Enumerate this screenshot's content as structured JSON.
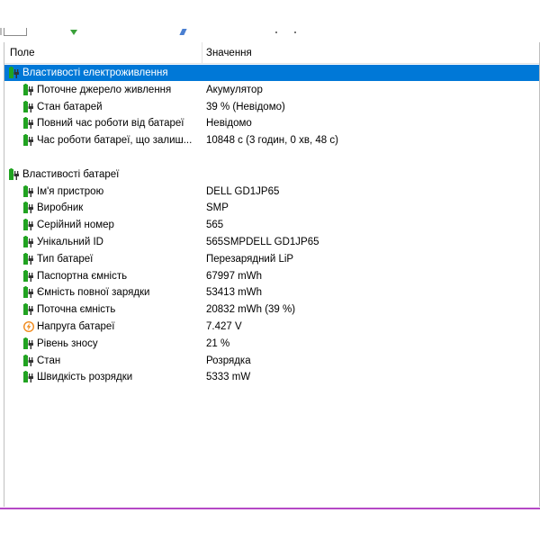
{
  "columns": {
    "field": "Поле",
    "value": "Значення"
  },
  "groups": [
    {
      "label": "Властивості електроживлення",
      "selected": true,
      "items": [
        {
          "name": "Поточне джерело живлення",
          "value": "Акумулятор",
          "icon": "battery-plug-icon"
        },
        {
          "name": "Стан батарей",
          "value": "39 % (Невідомо)",
          "icon": "battery-plug-icon"
        },
        {
          "name": "Повний час роботи від батареї",
          "value": "Невідомо",
          "icon": "battery-plug-icon"
        },
        {
          "name": "Час роботи батареї, що залиш...",
          "value": "10848 с (3 годин, 0 хв, 48 с)",
          "icon": "battery-plug-icon"
        }
      ]
    },
    {
      "label": "Властивості батареї",
      "selected": false,
      "items": [
        {
          "name": "Ім'я пристрою",
          "value": "DELL GD1JP65",
          "icon": "battery-plug-icon"
        },
        {
          "name": "Виробник",
          "value": "SMP",
          "icon": "battery-plug-icon"
        },
        {
          "name": "Серійний номер",
          "value": "565",
          "icon": "battery-plug-icon"
        },
        {
          "name": "Унікальний ID",
          "value": "565SMPDELL GD1JP65",
          "icon": "battery-plug-icon"
        },
        {
          "name": "Тип батареї",
          "value": "Перезарядний LiP",
          "icon": "battery-plug-icon"
        },
        {
          "name": "Паспортна ємність",
          "value": "67997 mWh",
          "icon": "battery-plug-icon"
        },
        {
          "name": "Ємність повної зарядки",
          "value": "53413 mWh",
          "icon": "battery-plug-icon"
        },
        {
          "name": "Поточна ємність",
          "value": "20832 mWh  (39 %)",
          "icon": "battery-plug-icon"
        },
        {
          "name": "Напруга батареї",
          "value": "7.427 V",
          "icon": "voltage-icon"
        },
        {
          "name": "Рівень зносу",
          "value": "21 %",
          "icon": "battery-plug-icon"
        },
        {
          "name": "Стан",
          "value": "Розрядка",
          "icon": "battery-plug-icon"
        },
        {
          "name": "Швидкість розрядки",
          "value": "5333 mW",
          "icon": "battery-plug-icon"
        }
      ]
    }
  ],
  "colors": {
    "selection": "#0078d7",
    "battery_green": "#21a321",
    "accent_line": "#b548c6",
    "voltage_orange": "#f08a1c"
  }
}
